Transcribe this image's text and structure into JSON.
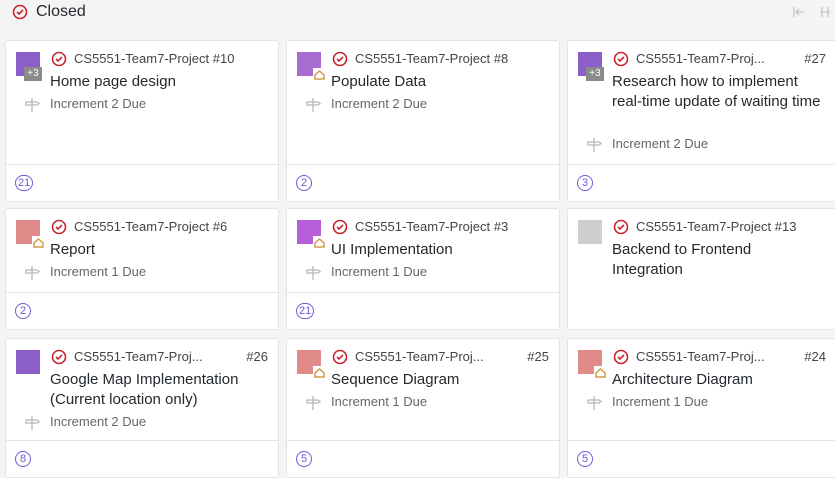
{
  "header": {
    "title": "Closed"
  },
  "cards": [
    {
      "repo": "CS5551-Team7-Project #10",
      "number": "",
      "title": "Home page design",
      "milestone": "Increment 2 Due",
      "estimate": "21",
      "extra": "+3",
      "avatar_color": "#8b5fc7"
    },
    {
      "repo": "CS5551-Team7-Project #8",
      "number": "",
      "title": "Populate Data",
      "milestone": "Increment 2 Due",
      "estimate": "2",
      "avatar_color": "#a86bd0"
    },
    {
      "repo": "CS5551-Team7-Proj...",
      "number": "#27",
      "title": "Research how to implement real-time update of waiting time",
      "milestone": "Increment 2 Due",
      "estimate": "3",
      "extra": "+3",
      "avatar_color": "#8b5fc7"
    },
    {
      "repo": "CS5551-Team7-Project #6",
      "number": "",
      "title": "Report",
      "milestone": "Increment 1 Due",
      "estimate": "2",
      "avatar_color": "#e08a8a"
    },
    {
      "repo": "CS5551-Team7-Project #3",
      "number": "",
      "title": "UI Implementation",
      "milestone": "Increment 1 Due",
      "estimate": "21",
      "avatar_color": "#b65fd8"
    },
    {
      "repo": "CS5551-Team7-Project #13",
      "number": "",
      "title": "Backend to Frontend Integration",
      "milestone": "",
      "estimate": "",
      "avatar_color": "#cfcfcf"
    },
    {
      "repo": "CS5551-Team7-Proj...",
      "number": "#26",
      "title": "Google Map Implementation (Current location only)",
      "milestone": "Increment 2 Due",
      "estimate": "8",
      "avatar_color": "#8b5fc7"
    },
    {
      "repo": "CS5551-Team7-Proj...",
      "number": "#25",
      "title": "Sequence Diagram",
      "milestone": "Increment 1 Due",
      "estimate": "5",
      "avatar_color": "#e08a8a"
    },
    {
      "repo": "CS5551-Team7-Proj...",
      "number": "#24",
      "title": "Architecture Diagram",
      "milestone": "Increment 1 Due",
      "estimate": "5",
      "avatar_color": "#e08a8a"
    }
  ]
}
